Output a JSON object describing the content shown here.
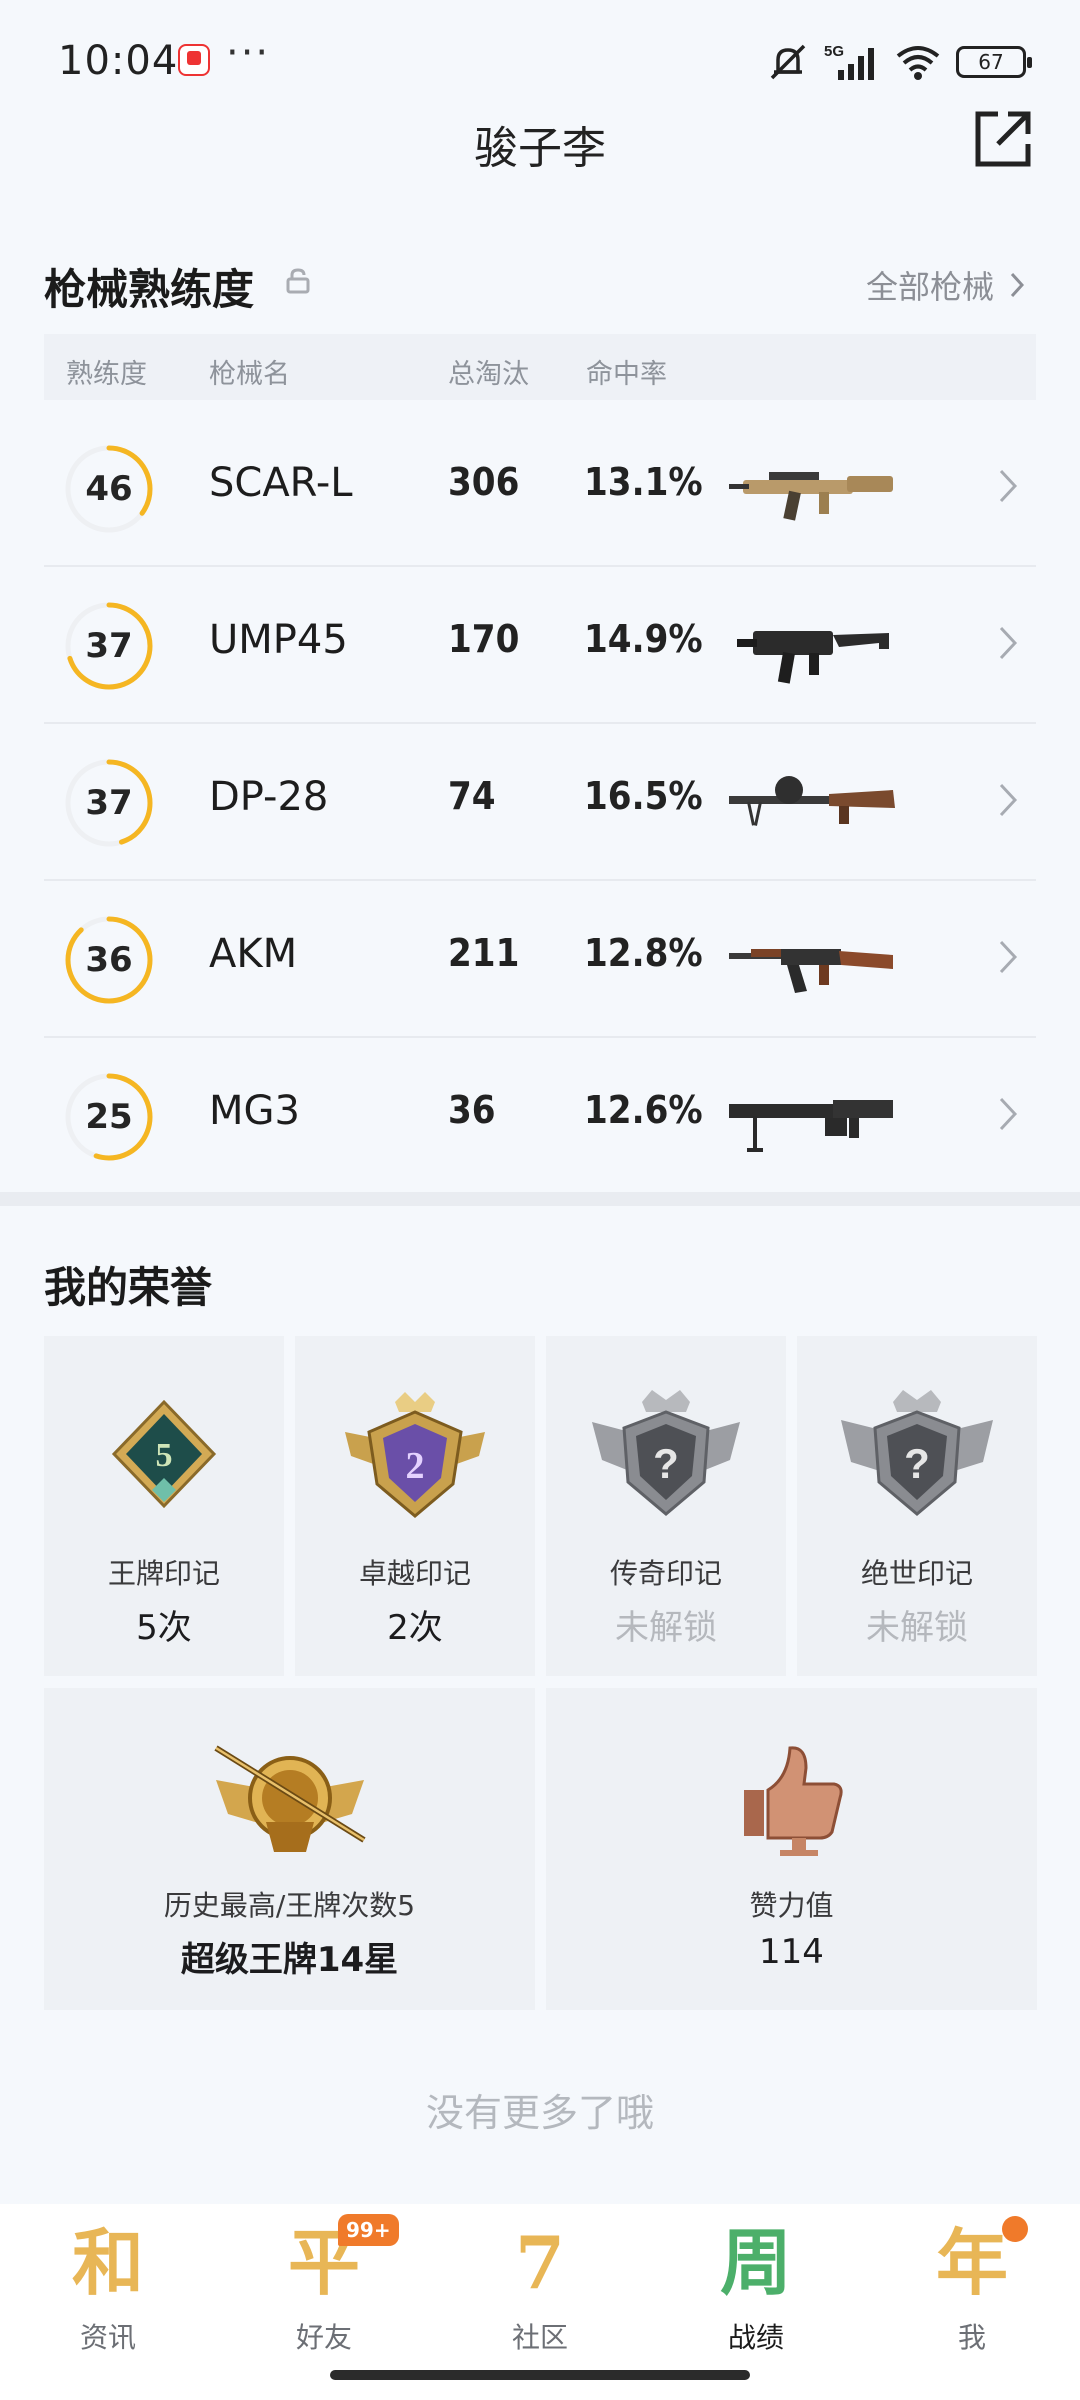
{
  "status": {
    "time": "10:04",
    "dots": "···",
    "network": "5G",
    "battery": "67"
  },
  "header": {
    "title": "骏子李"
  },
  "weapons": {
    "title": "枪械熟练度",
    "all_link": "全部枪械",
    "columns": {
      "proficiency": "熟练度",
      "name": "枪械名",
      "kills": "总淘汰",
      "accuracy": "命中率"
    },
    "rows": [
      {
        "level": "46",
        "progress": 0.35,
        "name": "SCAR-L",
        "kills": "306",
        "accuracy": "13.1%",
        "icon": "scar-l-rifle-icon"
      },
      {
        "level": "37",
        "progress": 0.7,
        "name": "UMP45",
        "kills": "170",
        "accuracy": "14.9%",
        "icon": "ump45-smg-icon"
      },
      {
        "level": "37",
        "progress": 0.45,
        "name": "DP-28",
        "kills": "74",
        "accuracy": "16.5%",
        "icon": "dp28-lmg-icon"
      },
      {
        "level": "36",
        "progress": 0.88,
        "name": "AKM",
        "kills": "211",
        "accuracy": "12.8%",
        "icon": "akm-rifle-icon"
      },
      {
        "level": "25",
        "progress": 0.55,
        "name": "MG3",
        "kills": "36",
        "accuracy": "12.6%",
        "icon": "mg3-lmg-icon"
      }
    ]
  },
  "honors": {
    "title": "我的荣誉",
    "cards": [
      {
        "label": "王牌印记",
        "value": "5次",
        "locked": false,
        "badge_text": "5"
      },
      {
        "label": "卓越印记",
        "value": "2次",
        "locked": false,
        "badge_text": "2"
      },
      {
        "label": "传奇印记",
        "value": "未解锁",
        "locked": true,
        "badge_text": "?"
      },
      {
        "label": "绝世印记",
        "value": "未解锁",
        "locked": true,
        "badge_text": "?"
      }
    ],
    "highest": {
      "label": "历史最高/王牌次数5",
      "value": "超级王牌14星"
    },
    "likes": {
      "label": "赞力值",
      "value": "114"
    }
  },
  "footer": {
    "no_more": "没有更多了哦"
  },
  "tabs": [
    {
      "glyph": "和",
      "label": "资讯",
      "active": false
    },
    {
      "glyph": "平",
      "label": "好友",
      "active": false,
      "badge": "99+"
    },
    {
      "glyph": "7",
      "label": "社区",
      "active": false
    },
    {
      "glyph": "周",
      "label": "战绩",
      "active": true
    },
    {
      "glyph": "年",
      "label": "我",
      "active": false,
      "dot": true
    }
  ],
  "colors": {
    "accent": "#f5b622",
    "ring_track": "#eef0f3",
    "tab_gold": "#e8b656",
    "badge_orange": "#f07a2a"
  }
}
